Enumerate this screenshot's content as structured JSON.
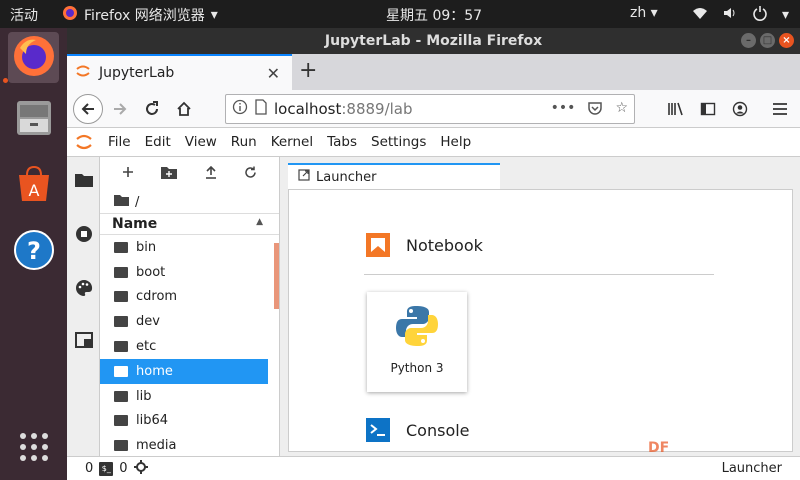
{
  "topbar": {
    "activities": "活动",
    "app_name": "Firefox 网络浏览器",
    "clock": "星期五 09：57",
    "language": "zh"
  },
  "window": {
    "title": "JupyterLab - Mozilla Firefox"
  },
  "browser": {
    "tab_title": "JupyterLab",
    "url_host": "localhost",
    "url_path": ":8889/lab"
  },
  "jupyter": {
    "menu": [
      "File",
      "Edit",
      "View",
      "Run",
      "Kernel",
      "Tabs",
      "Settings",
      "Help"
    ],
    "breadcrumb": "/",
    "name_header": "Name",
    "files": [
      {
        "name": "bin",
        "selected": false
      },
      {
        "name": "boot",
        "selected": false
      },
      {
        "name": "cdrom",
        "selected": false
      },
      {
        "name": "dev",
        "selected": false
      },
      {
        "name": "etc",
        "selected": false
      },
      {
        "name": "home",
        "selected": true
      },
      {
        "name": "lib",
        "selected": false
      },
      {
        "name": "lib64",
        "selected": false
      },
      {
        "name": "media",
        "selected": false
      }
    ],
    "doc_tab": "Launcher",
    "notebook_section": "Notebook",
    "kernel_card": "Python 3",
    "console_section": "Console"
  },
  "statusbar": {
    "count_a": "0",
    "count_b": "0",
    "right_label": "Launcher"
  },
  "watermark": "DF"
}
